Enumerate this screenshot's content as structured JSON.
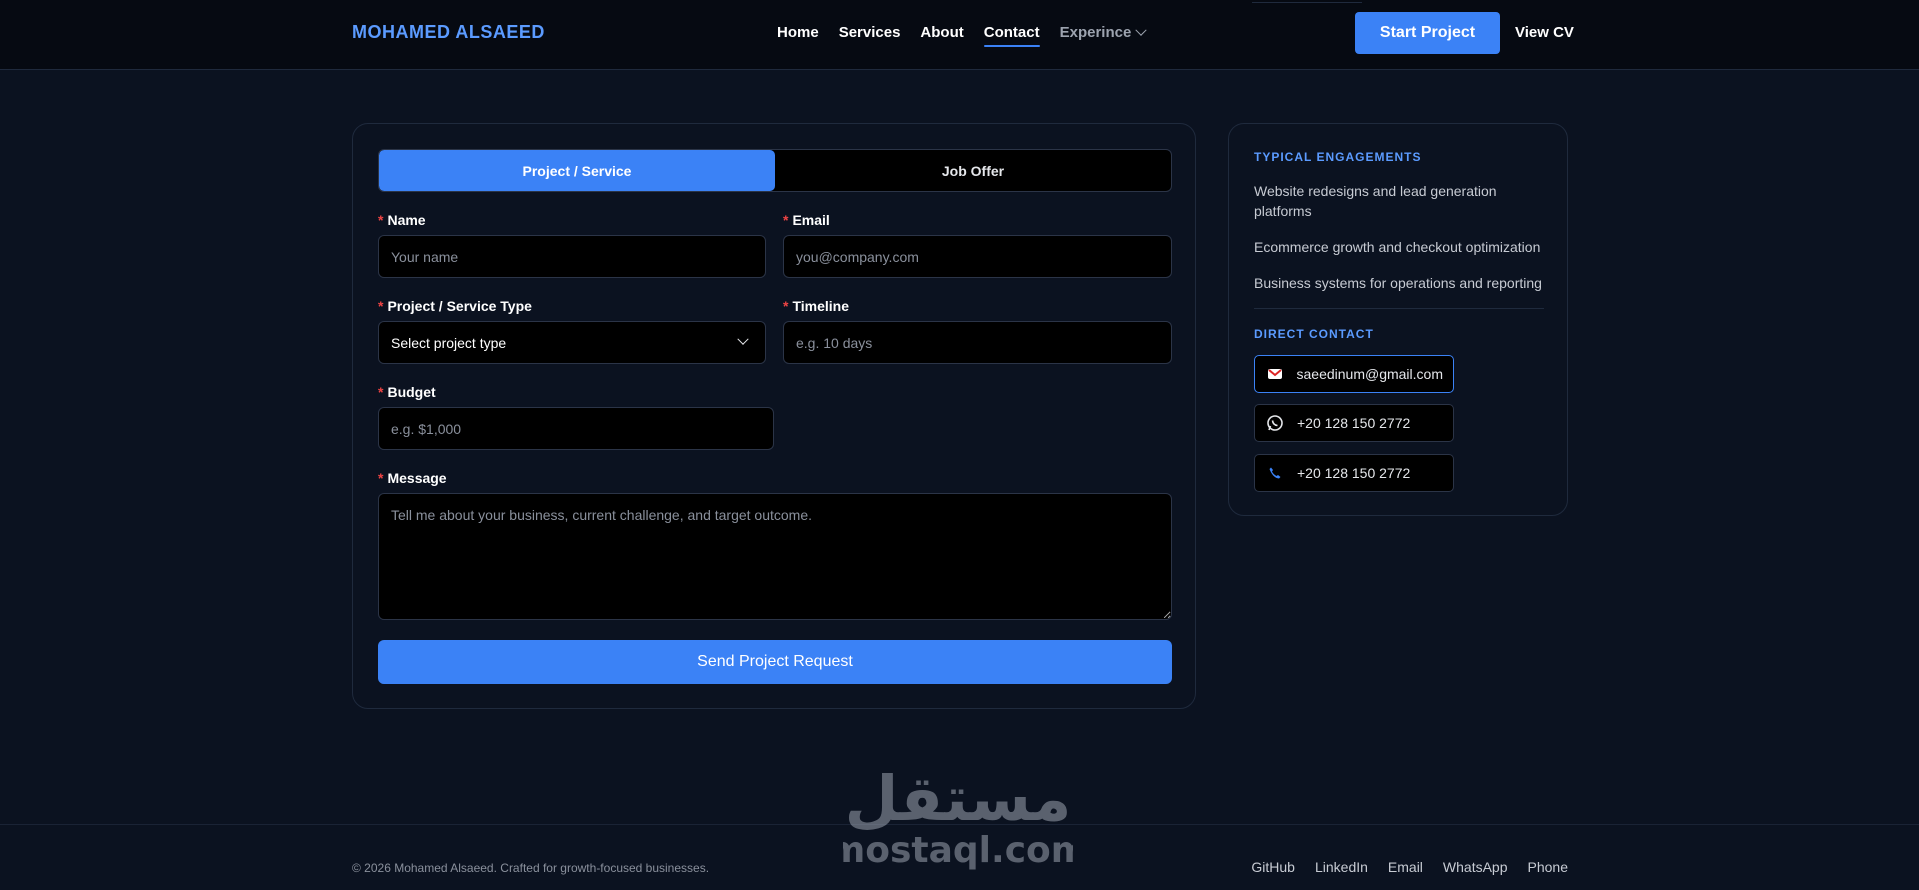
{
  "header": {
    "brand": "MOHAMED ALSAEED",
    "nav": [
      "Home",
      "Services",
      "About",
      "Contact"
    ],
    "nav_dropdown": "Experince",
    "start_project": "Start Project",
    "view_cv": "View CV"
  },
  "form": {
    "tabs": [
      "Project / Service",
      "Job Offer"
    ],
    "name": {
      "label": "Name",
      "placeholder": "Your name"
    },
    "email": {
      "label": "Email",
      "placeholder": "you@company.com"
    },
    "type": {
      "label": "Project / Service Type",
      "value": "Select project type"
    },
    "timeline": {
      "label": "Timeline",
      "placeholder": "e.g. 10 days"
    },
    "budget": {
      "label": "Budget",
      "placeholder": "e.g. $1,000"
    },
    "message": {
      "label": "Message",
      "placeholder": "Tell me about your business, current challenge, and target outcome."
    },
    "submit": "Send Project Request"
  },
  "side": {
    "engagements_title": "TYPICAL ENGAGEMENTS",
    "engagements": [
      "Website redesigns and lead generation platforms",
      "Ecommerce growth and checkout optimization",
      "Business systems for operations and reporting"
    ],
    "contact_title": "DIRECT CONTACT",
    "contacts": [
      {
        "icon": "gmail-icon",
        "text": "saeedinum@gmail.com"
      },
      {
        "icon": "whatsapp-icon",
        "text": "+20 128 150 2772"
      },
      {
        "icon": "phone-icon",
        "text": "+20 128 150 2772"
      }
    ]
  },
  "footer": {
    "copyright": "© 2026 Mohamed Alsaeed. Crafted for growth-focused businesses.",
    "links": [
      "GitHub",
      "LinkedIn",
      "Email",
      "WhatsApp",
      "Phone"
    ]
  },
  "watermark": {
    "arabic": "مستقل",
    "latin": "mostaql.com"
  },
  "colors": {
    "accent": "#3b82f6",
    "brand": "#5b9bff",
    "background": "#0b1220",
    "required": "#ef4444"
  }
}
